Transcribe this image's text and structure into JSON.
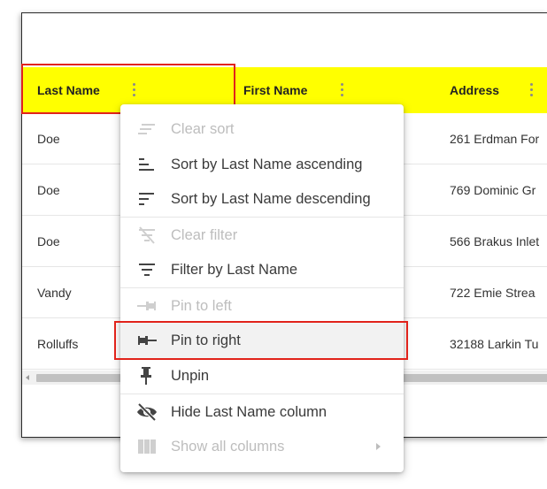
{
  "columns": {
    "last_name": "Last Name",
    "first_name": "First Name",
    "address": "Address"
  },
  "rows": [
    {
      "last_name": "Doe",
      "address": "261 Erdman For"
    },
    {
      "last_name": "Doe",
      "address": "769 Dominic Gr"
    },
    {
      "last_name": "Doe",
      "address": "566 Brakus Inlet"
    },
    {
      "last_name": "Vandy",
      "address": "722 Emie Strea"
    },
    {
      "last_name": "Rolluffs",
      "address": "32188 Larkin Tu"
    }
  ],
  "menu": {
    "clear_sort": "Clear sort",
    "sort_asc": "Sort by Last Name ascending",
    "sort_desc": "Sort by Last Name descending",
    "clear_filter": "Clear filter",
    "filter": "Filter by Last Name",
    "pin_left": "Pin to left",
    "pin_right": "Pin to right",
    "unpin": "Unpin",
    "hide_column": "Hide Last Name column",
    "show_all": "Show all columns"
  },
  "icons": {
    "clear_sort": "clear-sort-icon",
    "sort_asc": "sort-ascending-icon",
    "sort_desc": "sort-descending-icon",
    "clear_filter": "filter-off-icon",
    "filter": "filter-icon",
    "pin_left": "pin-left-icon",
    "pin_right": "pin-right-icon",
    "unpin": "pin-icon",
    "hide_column": "eye-off-icon",
    "show_all": "columns-icon"
  },
  "colors": {
    "header_bg": "#ffff00",
    "highlight": "#e1231b",
    "menu_text": "#3a3a3a",
    "disabled_text": "#bdbdbd"
  }
}
